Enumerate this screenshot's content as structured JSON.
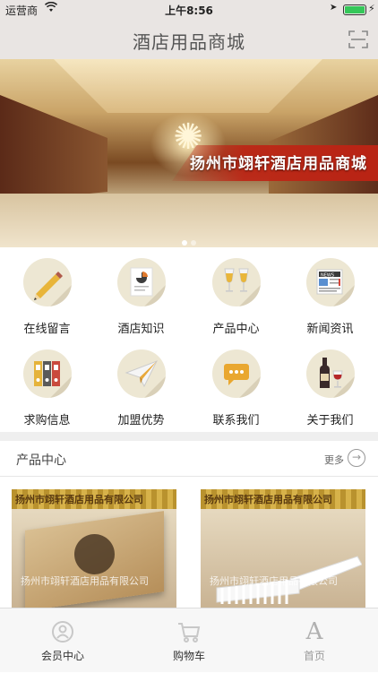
{
  "status_bar": {
    "carrier": "运营商",
    "time": "上午8:56"
  },
  "nav": {
    "title": "酒店用品商城",
    "scan_icon": "scan-frame-icon"
  },
  "banner": {
    "slogan": "扬州市翊轩酒店用品商城",
    "dots": 2,
    "active_dot": 1
  },
  "grid": {
    "items": [
      {
        "label": "在线留言",
        "icon": "pencil-icon"
      },
      {
        "label": "酒店知识",
        "icon": "document-chart-icon"
      },
      {
        "label": "产品中心",
        "icon": "wine-glasses-icon"
      },
      {
        "label": "新闻资讯",
        "icon": "newspaper-icon"
      },
      {
        "label": "求购信息",
        "icon": "binders-icon"
      },
      {
        "label": "加盟优势",
        "icon": "paper-plane-icon"
      },
      {
        "label": "联系我们",
        "icon": "chat-bubble-icon"
      },
      {
        "label": "关于我们",
        "icon": "wine-bottle-icon"
      }
    ]
  },
  "section": {
    "title": "产品中心",
    "more_label": "更多"
  },
  "products": [
    {
      "banner_text": "扬州市翊轩酒店用品有限公司",
      "watermark": "扬州市翊轩酒店用品有限公司"
    },
    {
      "banner_text": "扬州市翊轩酒店用品有限公司",
      "watermark": "扬州市翊轩酒店用品有限公司"
    }
  ],
  "tabs": [
    {
      "label": "会员中心",
      "icon": "member-icon"
    },
    {
      "label": "购物车",
      "icon": "cart-icon"
    },
    {
      "label": "首页",
      "icon": "home-a-icon",
      "glyph": "A"
    }
  ],
  "colors": {
    "header_bg": "#e9e5e3",
    "icon_circle": "#ede7d3",
    "battery": "#35c759",
    "slogan_bg": "#be2314"
  }
}
